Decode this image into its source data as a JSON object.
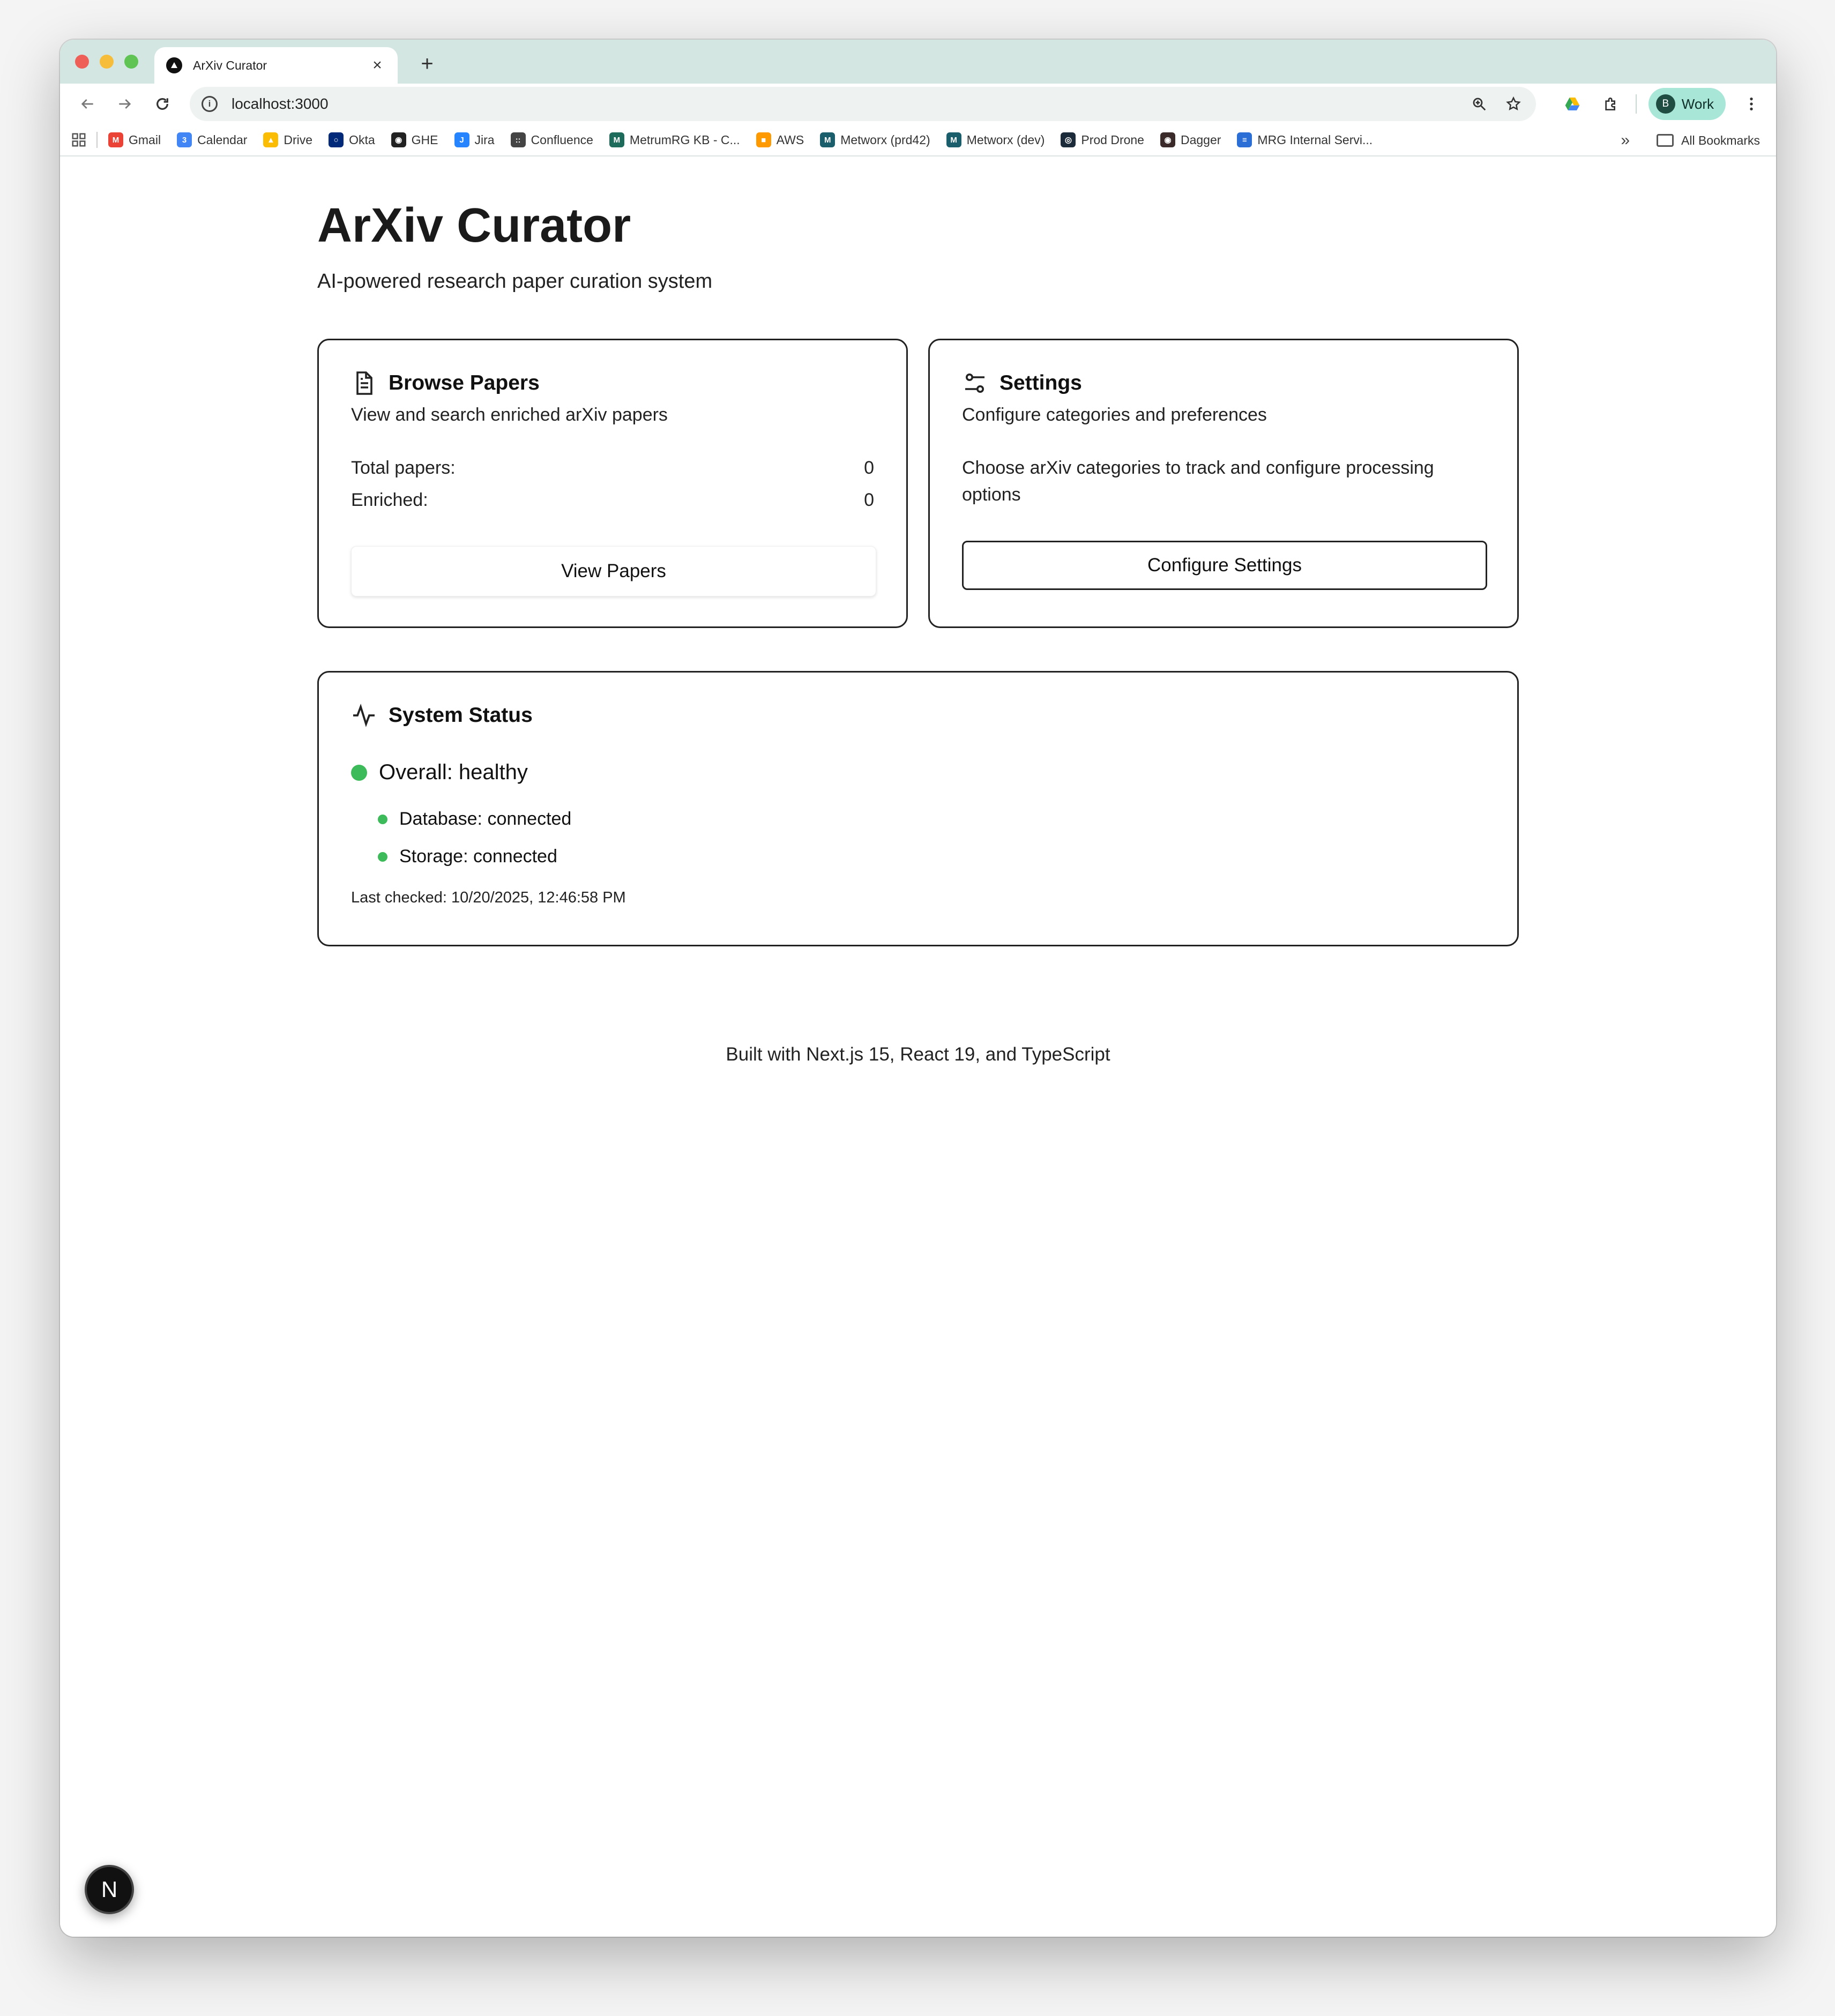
{
  "browser": {
    "tab_title": "ArXiv Curator",
    "new_tab_symbol": "+",
    "tab_close_symbol": "×",
    "url": "localhost:3000",
    "profile_initial": "B",
    "profile_label": "Work",
    "bookmarks": [
      {
        "label": "Gmail",
        "icon": "gmail-icon",
        "color": "#ea4335",
        "glyph": "M"
      },
      {
        "label": "Calendar",
        "icon": "calendar-icon",
        "color": "#4285f4",
        "glyph": "3"
      },
      {
        "label": "Drive",
        "icon": "drive-icon",
        "color": "#fbbc04",
        "glyph": "▲"
      },
      {
        "label": "Okta",
        "icon": "okta-icon",
        "color": "#00297a",
        "glyph": "○"
      },
      {
        "label": "GHE",
        "icon": "github-icon",
        "color": "#222222",
        "glyph": "◉"
      },
      {
        "label": "Jira",
        "icon": "jira-icon",
        "color": "#2684ff",
        "glyph": "J"
      },
      {
        "label": "Confluence",
        "icon": "confluence-icon",
        "color": "#444444",
        "glyph": "::"
      },
      {
        "label": "MetrumRG KB - C...",
        "icon": "metrum-icon",
        "color": "#1d6b5a",
        "glyph": "M"
      },
      {
        "label": "AWS",
        "icon": "aws-icon",
        "color": "#ff9900",
        "glyph": "■"
      },
      {
        "label": "Metworx (prd42)",
        "icon": "metworx-icon",
        "color": "#1b5e6b",
        "glyph": "M"
      },
      {
        "label": "Metworx (dev)",
        "icon": "metworx-icon",
        "color": "#1b5e6b",
        "glyph": "M"
      },
      {
        "label": "Prod Drone",
        "icon": "drone-icon",
        "color": "#1c2b3a",
        "glyph": "◎"
      },
      {
        "label": "Dagger",
        "icon": "dagger-icon",
        "color": "#3a2a2a",
        "glyph": "◉"
      },
      {
        "label": "MRG Internal Servi...",
        "icon": "mrg-icon",
        "color": "#2b6fd6",
        "glyph": "≡"
      }
    ],
    "bookmarks_more": "»",
    "all_bookmarks": "All Bookmarks"
  },
  "header": {
    "title": "ArXiv Curator",
    "subtitle": "AI-powered research paper curation system"
  },
  "browse_card": {
    "title": "Browse Papers",
    "description": "View and search enriched arXiv papers",
    "stats": [
      {
        "label": "Total papers:",
        "value": "0"
      },
      {
        "label": "Enriched:",
        "value": "0"
      }
    ],
    "button_label": "View Papers"
  },
  "settings_card": {
    "title": "Settings",
    "description": "Configure categories and preferences",
    "body": "Choose arXiv categories to track and configure processing options",
    "button_label": "Configure Settings"
  },
  "status_card": {
    "title": "System Status",
    "overall": "Overall: healthy",
    "services": [
      {
        "label": "Database: connected"
      },
      {
        "label": "Storage: connected"
      }
    ],
    "last_checked": "Last checked: 10/20/2025, 12:46:58 PM",
    "status_color": "#3dbb5a"
  },
  "footer": {
    "text": "Built with Next.js 15, React 19, and TypeScript"
  },
  "dev_badge": {
    "label": "N"
  }
}
